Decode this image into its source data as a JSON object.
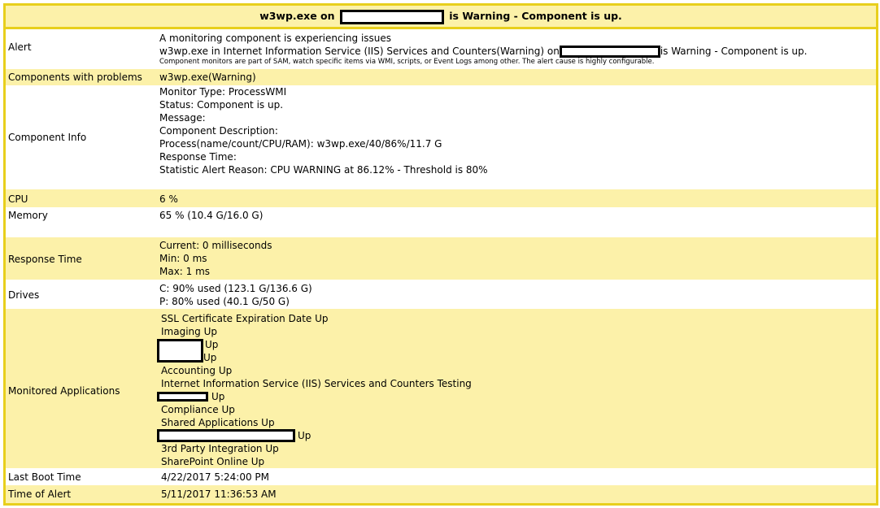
{
  "header": {
    "title_prefix": "w3wp.exe on",
    "title_suffix": "is Warning - Component is up."
  },
  "alert": {
    "label": "Alert",
    "line1": "A monitoring component is experiencing issues",
    "line2_prefix": "w3wp.exe in Internet Information Service (IIS) Services and Counters(Warning) on",
    "line2_suffix": "is Warning - Component is up.",
    "note": "Component monitors are part of SAM, watch specific items via WMI, scripts, or Event Logs among other. The alert cause is highly configurable."
  },
  "components": {
    "label": "Components with problems",
    "value": "w3wp.exe(Warning)"
  },
  "component_info": {
    "label": "Component Info",
    "lines": [
      "Monitor Type: ProcessWMI",
      "Status: Component is up.",
      "Message:",
      "Component Description:",
      "Process(name/count/CPU/RAM): w3wp.exe/40/86%/11.7 G",
      "Response Time:",
      "Statistic Alert Reason: CPU WARNING at 86.12% - Threshold is 80%"
    ]
  },
  "cpu": {
    "label": "CPU",
    "value": "6 %"
  },
  "memory": {
    "label": "Memory",
    "value": "65 % (10.4 G/16.0 G)"
  },
  "response_time": {
    "label": "Response Time",
    "lines": [
      "Current: 0 milliseconds",
      "Min: 0 ms",
      "Max: 1 ms"
    ]
  },
  "drives": {
    "label": "Drives",
    "lines": [
      "C: 90% used (123.1 G/136.6 G)",
      "P: 80% used (40.1 G/50 G)"
    ]
  },
  "monitored_apps": {
    "label": "Monitored Applications",
    "items": [
      "SSL Certificate Expiration Date Up",
      "Imaging Up",
      "Up",
      "Up",
      "Accounting Up",
      "Internet Information Service (IIS) Services and Counters Testing",
      "Up",
      "Compliance Up",
      "Shared Applications Up",
      "Up",
      "3rd Party Integration Up",
      "SharePoint Online Up"
    ]
  },
  "last_boot": {
    "label": "Last Boot Time",
    "value": "4/22/2017 5:24:00 PM"
  },
  "time_of_alert": {
    "label": "Time of Alert",
    "value": "5/11/2017 11:36:53 AM"
  },
  "colors": {
    "border": "#e8cf1c",
    "row_highlight": "#fcf1a9",
    "row_plain": "#ffffff"
  }
}
